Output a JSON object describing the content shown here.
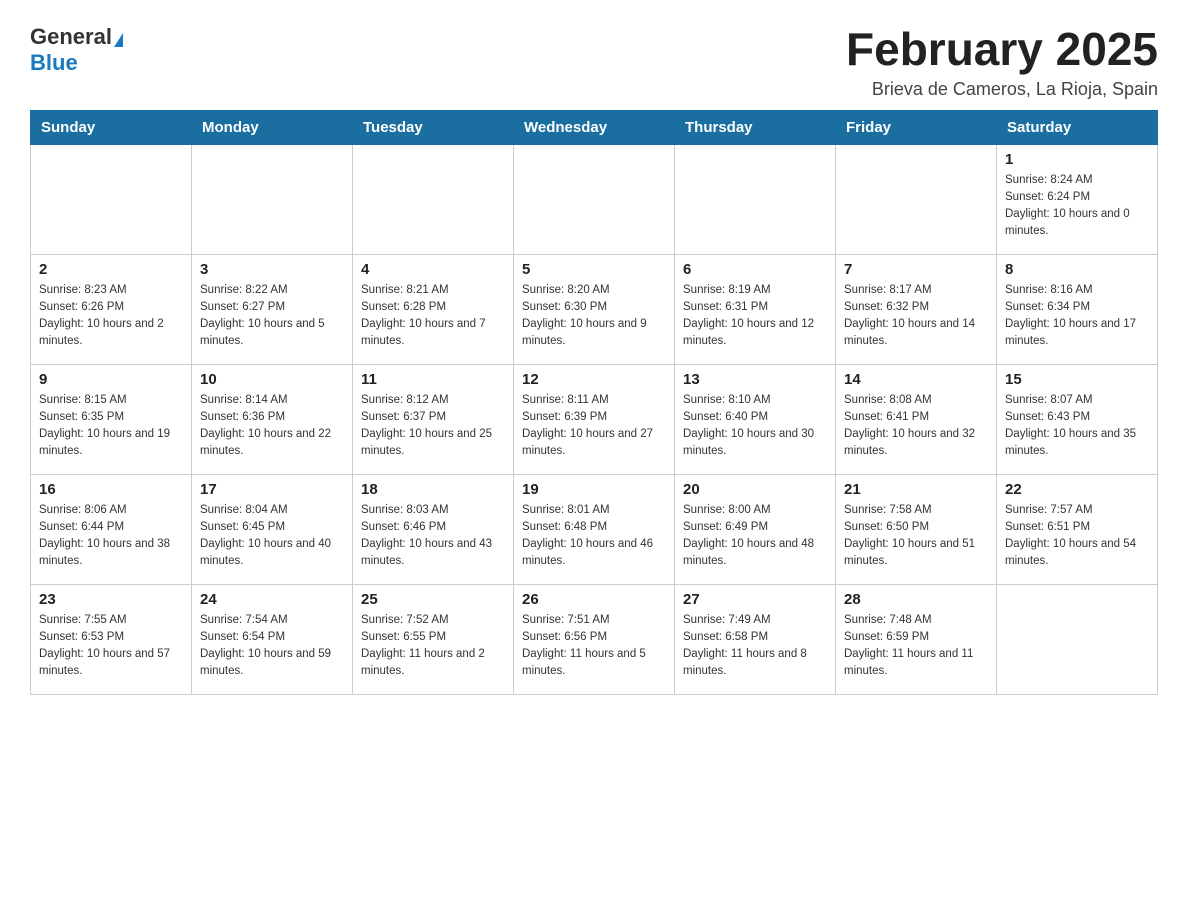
{
  "header": {
    "logo_general": "General",
    "logo_blue": "Blue",
    "month_title": "February 2025",
    "location": "Brieva de Cameros, La Rioja, Spain"
  },
  "weekdays": [
    "Sunday",
    "Monday",
    "Tuesday",
    "Wednesday",
    "Thursday",
    "Friday",
    "Saturday"
  ],
  "weeks": [
    [
      {
        "day": "",
        "info": ""
      },
      {
        "day": "",
        "info": ""
      },
      {
        "day": "",
        "info": ""
      },
      {
        "day": "",
        "info": ""
      },
      {
        "day": "",
        "info": ""
      },
      {
        "day": "",
        "info": ""
      },
      {
        "day": "1",
        "info": "Sunrise: 8:24 AM\nSunset: 6:24 PM\nDaylight: 10 hours and 0 minutes."
      }
    ],
    [
      {
        "day": "2",
        "info": "Sunrise: 8:23 AM\nSunset: 6:26 PM\nDaylight: 10 hours and 2 minutes."
      },
      {
        "day": "3",
        "info": "Sunrise: 8:22 AM\nSunset: 6:27 PM\nDaylight: 10 hours and 5 minutes."
      },
      {
        "day": "4",
        "info": "Sunrise: 8:21 AM\nSunset: 6:28 PM\nDaylight: 10 hours and 7 minutes."
      },
      {
        "day": "5",
        "info": "Sunrise: 8:20 AM\nSunset: 6:30 PM\nDaylight: 10 hours and 9 minutes."
      },
      {
        "day": "6",
        "info": "Sunrise: 8:19 AM\nSunset: 6:31 PM\nDaylight: 10 hours and 12 minutes."
      },
      {
        "day": "7",
        "info": "Sunrise: 8:17 AM\nSunset: 6:32 PM\nDaylight: 10 hours and 14 minutes."
      },
      {
        "day": "8",
        "info": "Sunrise: 8:16 AM\nSunset: 6:34 PM\nDaylight: 10 hours and 17 minutes."
      }
    ],
    [
      {
        "day": "9",
        "info": "Sunrise: 8:15 AM\nSunset: 6:35 PM\nDaylight: 10 hours and 19 minutes."
      },
      {
        "day": "10",
        "info": "Sunrise: 8:14 AM\nSunset: 6:36 PM\nDaylight: 10 hours and 22 minutes."
      },
      {
        "day": "11",
        "info": "Sunrise: 8:12 AM\nSunset: 6:37 PM\nDaylight: 10 hours and 25 minutes."
      },
      {
        "day": "12",
        "info": "Sunrise: 8:11 AM\nSunset: 6:39 PM\nDaylight: 10 hours and 27 minutes."
      },
      {
        "day": "13",
        "info": "Sunrise: 8:10 AM\nSunset: 6:40 PM\nDaylight: 10 hours and 30 minutes."
      },
      {
        "day": "14",
        "info": "Sunrise: 8:08 AM\nSunset: 6:41 PM\nDaylight: 10 hours and 32 minutes."
      },
      {
        "day": "15",
        "info": "Sunrise: 8:07 AM\nSunset: 6:43 PM\nDaylight: 10 hours and 35 minutes."
      }
    ],
    [
      {
        "day": "16",
        "info": "Sunrise: 8:06 AM\nSunset: 6:44 PM\nDaylight: 10 hours and 38 minutes."
      },
      {
        "day": "17",
        "info": "Sunrise: 8:04 AM\nSunset: 6:45 PM\nDaylight: 10 hours and 40 minutes."
      },
      {
        "day": "18",
        "info": "Sunrise: 8:03 AM\nSunset: 6:46 PM\nDaylight: 10 hours and 43 minutes."
      },
      {
        "day": "19",
        "info": "Sunrise: 8:01 AM\nSunset: 6:48 PM\nDaylight: 10 hours and 46 minutes."
      },
      {
        "day": "20",
        "info": "Sunrise: 8:00 AM\nSunset: 6:49 PM\nDaylight: 10 hours and 48 minutes."
      },
      {
        "day": "21",
        "info": "Sunrise: 7:58 AM\nSunset: 6:50 PM\nDaylight: 10 hours and 51 minutes."
      },
      {
        "day": "22",
        "info": "Sunrise: 7:57 AM\nSunset: 6:51 PM\nDaylight: 10 hours and 54 minutes."
      }
    ],
    [
      {
        "day": "23",
        "info": "Sunrise: 7:55 AM\nSunset: 6:53 PM\nDaylight: 10 hours and 57 minutes."
      },
      {
        "day": "24",
        "info": "Sunrise: 7:54 AM\nSunset: 6:54 PM\nDaylight: 10 hours and 59 minutes."
      },
      {
        "day": "25",
        "info": "Sunrise: 7:52 AM\nSunset: 6:55 PM\nDaylight: 11 hours and 2 minutes."
      },
      {
        "day": "26",
        "info": "Sunrise: 7:51 AM\nSunset: 6:56 PM\nDaylight: 11 hours and 5 minutes."
      },
      {
        "day": "27",
        "info": "Sunrise: 7:49 AM\nSunset: 6:58 PM\nDaylight: 11 hours and 8 minutes."
      },
      {
        "day": "28",
        "info": "Sunrise: 7:48 AM\nSunset: 6:59 PM\nDaylight: 11 hours and 11 minutes."
      },
      {
        "day": "",
        "info": ""
      }
    ]
  ]
}
